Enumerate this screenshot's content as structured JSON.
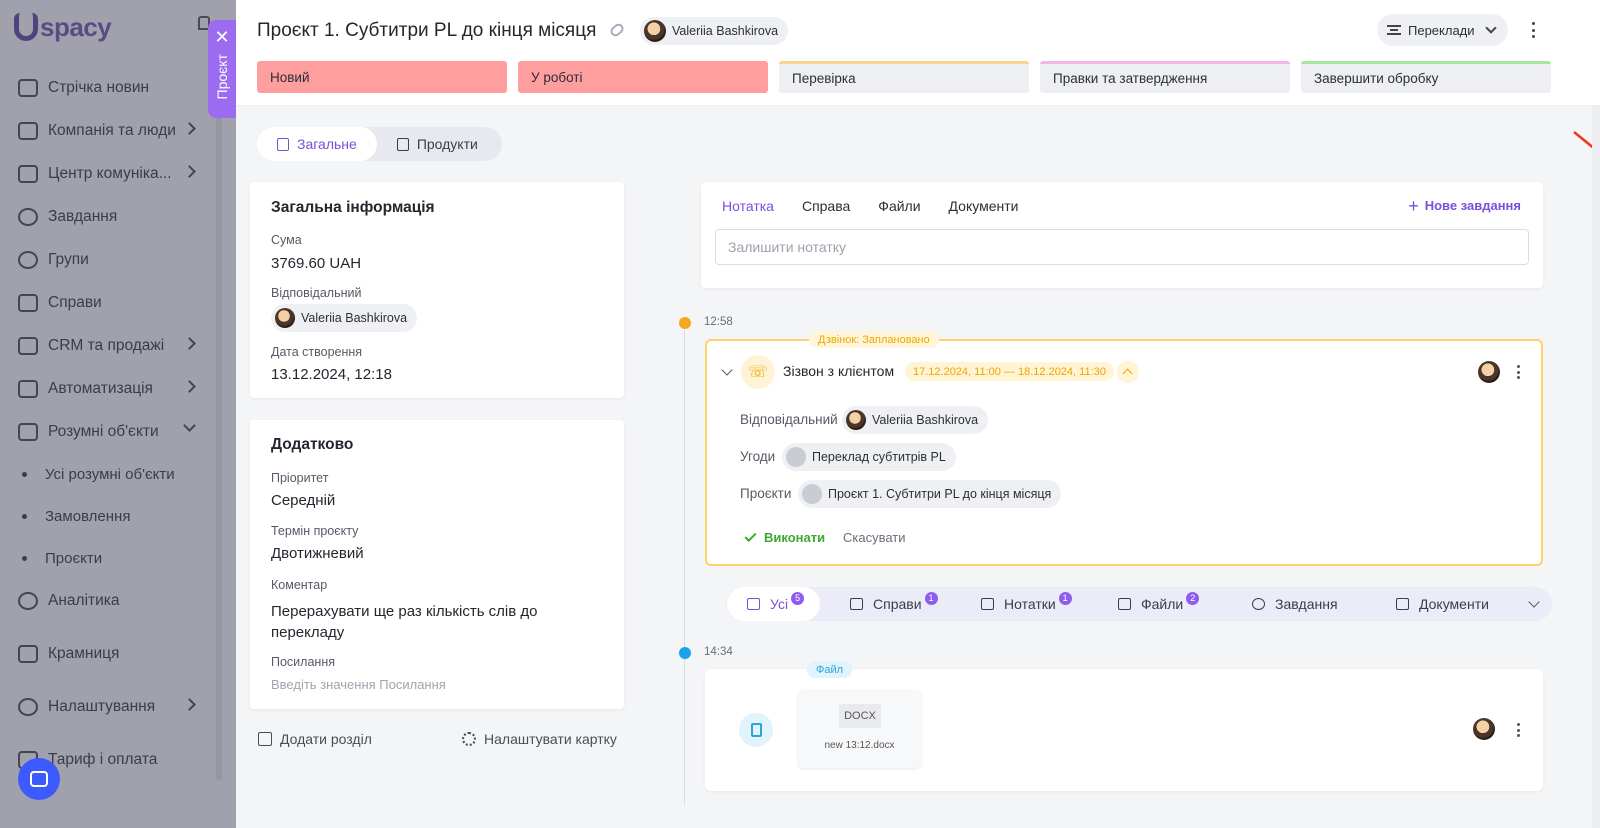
{
  "sidebar": {
    "logo_text": "spacy",
    "items": [
      {
        "label": "Стрічка новин",
        "icon": "news-icon"
      },
      {
        "label": "Компанія та люди",
        "icon": "company-icon"
      },
      {
        "label": "Центр комуніка...",
        "icon": "chat-icon"
      },
      {
        "label": "Завдання",
        "icon": "check-icon"
      },
      {
        "label": "Групи",
        "icon": "groups-icon"
      },
      {
        "label": "Справи",
        "icon": "calendar-icon"
      },
      {
        "label": "CRM та продажі",
        "icon": "crm-icon"
      },
      {
        "label": "Автоматизація",
        "icon": "bolt-icon"
      },
      {
        "label": "Розумні об'єкти",
        "icon": "smart-objects-icon"
      }
    ],
    "subitems": [
      "Усі розумні об'єкти",
      "Замовлення",
      "Проєкти"
    ],
    "items_bottom": [
      {
        "label": "Аналітика",
        "icon": "analytics-icon"
      },
      {
        "label": "Крамниця",
        "icon": "store-icon"
      },
      {
        "label": "Налаштування",
        "icon": "gear-icon"
      },
      {
        "label": "Тариф і оплата",
        "icon": "billing-icon"
      }
    ]
  },
  "project_tab": {
    "label": "Проєкт",
    "close": "✕"
  },
  "header": {
    "title": "Проєкт 1. Субтитри PL до кінця місяця",
    "owner": "Valeriia Bashkirova",
    "pipeline": "Переклади",
    "stages": [
      {
        "label": "Новий",
        "style": "red"
      },
      {
        "label": "У роботі",
        "style": "red"
      },
      {
        "label": "Перевірка",
        "style": "gray",
        "color": "#f7d58a"
      },
      {
        "label": "Правки та затвердження",
        "style": "gray",
        "color": "#f2b6e6"
      },
      {
        "label": "Завершити обробку",
        "style": "gray",
        "color": "#a6e6a0"
      }
    ]
  },
  "tabs": {
    "general": "Загальне",
    "products": "Продукти"
  },
  "general_info": {
    "title": "Загальна інформація",
    "sum_label": "Сума",
    "sum_value": "3769.60 UAH",
    "responsible_label": "Відповідальний",
    "responsible_value": "Valeriia Bashkirova",
    "created_label": "Дата створення",
    "created_value": "13.12.2024, 12:18"
  },
  "additional": {
    "title": "Додатково",
    "priority_label": "Пріоритет",
    "priority_value": "Середній",
    "term_label": "Термін проєкту",
    "term_value": "Двотижневий",
    "comment_label": "Коментар",
    "comment_value": "Перерахувати ще раз кількість слів до перекладу",
    "link_label": "Посилання",
    "link_placeholder": "Введіть значення Посилання"
  },
  "bottom_actions": {
    "add_section": "Додати розділ",
    "configure_card": "Налаштувати картку"
  },
  "note": {
    "tabs": [
      "Нотатка",
      "Справа",
      "Файли",
      "Документи"
    ],
    "new_task": "Нове завдання",
    "placeholder": "Залишити нотатку"
  },
  "timeline": [
    {
      "time": "12:58",
      "badge": "Дзвінок: Заплановано",
      "title": "Зізвон з клієнтом",
      "date_range": "17.12.2024, 11:00 — 18.12.2024, 11:30",
      "responsible_label": "Відповідальний",
      "responsible_value": "Valeriia Bashkirova",
      "deals_label": "Угоди",
      "deals_value": "Переклад субтитрів PL",
      "projects_label": "Проєкти",
      "projects_value": "Проєкт 1. Субтитри PL до кінця місяця",
      "done": "Виконати",
      "cancel": "Скасувати"
    },
    {
      "time": "14:34",
      "badge": "Файл",
      "file_ext": "DOCX",
      "file_name": "new 13:12.docx"
    }
  ],
  "filters": [
    {
      "label": "Усі",
      "count": "5"
    },
    {
      "label": "Справи",
      "count": "1"
    },
    {
      "label": "Нотатки",
      "count": "1"
    },
    {
      "label": "Файли",
      "count": "2"
    },
    {
      "label": "Завдання",
      "count": ""
    },
    {
      "label": "Документи",
      "count": ""
    }
  ],
  "colors": {
    "accent": "#7a4fdb",
    "call": "#f0a400",
    "file": "#2ba5d8",
    "arrow": "#f0341e"
  }
}
